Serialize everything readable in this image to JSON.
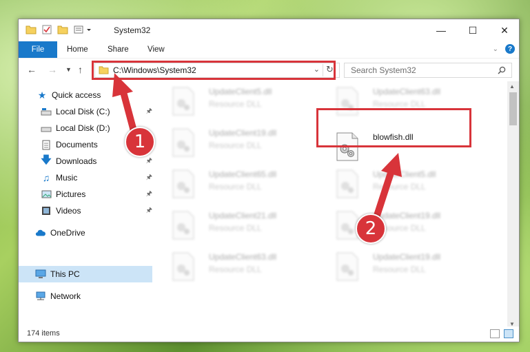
{
  "window": {
    "title": "System32",
    "controls": {
      "minimize": "—",
      "maximize": "☐",
      "close": "✕"
    }
  },
  "ribbon": {
    "file_tab": "File",
    "tabs": [
      "Home",
      "Share",
      "View"
    ]
  },
  "navigation": {
    "address": "C:\\Windows\\System32",
    "search_placeholder": "Search System32"
  },
  "sidebar": {
    "quick_access": "Quick access",
    "items": [
      {
        "label": "Local Disk (C:)",
        "icon": "drive-icon",
        "pinned": true
      },
      {
        "label": "Local Disk (D:)",
        "icon": "drive-icon",
        "pinned": false
      },
      {
        "label": "Documents",
        "icon": "documents-icon",
        "pinned": true
      },
      {
        "label": "Downloads",
        "icon": "download-icon",
        "pinned": true
      },
      {
        "label": "Music",
        "icon": "music-icon",
        "pinned": true
      },
      {
        "label": "Pictures",
        "icon": "pictures-icon",
        "pinned": true
      },
      {
        "label": "Videos",
        "icon": "videos-icon",
        "pinned": true
      }
    ],
    "onedrive": "OneDrive",
    "this_pc": "This PC",
    "network": "Network"
  },
  "files": [
    {
      "name": "UpdateClient5.dll",
      "type": "Resource DLL",
      "blurred": true
    },
    {
      "name": "UpdateClient63.dll",
      "type": "Resource DLL",
      "blurred": true
    },
    {
      "name": "UpdateClient19.dll",
      "type": "Resource DLL",
      "blurred": true
    },
    {
      "name": "blowfish.dll",
      "type": "",
      "blurred": false
    },
    {
      "name": "UpdateClient65.dll",
      "type": "Resource DLL",
      "blurred": true
    },
    {
      "name": "UpdateClient5.dll",
      "type": "Resource DLL",
      "blurred": true
    },
    {
      "name": "UpdateClient21.dll",
      "type": "Resource DLL",
      "blurred": true
    },
    {
      "name": "UpdateClient19.dll",
      "type": "Resource DLL",
      "blurred": true
    },
    {
      "name": "UpdateClient63.dll",
      "type": "Resource DLL",
      "blurred": true
    },
    {
      "name": "UpdateClient19.dll",
      "type": "Resource DLL",
      "blurred": true
    }
  ],
  "status": {
    "item_count": "174 items"
  },
  "annotations": {
    "step1": "1",
    "step2": "2"
  },
  "colors": {
    "accent": "#1979ca",
    "highlight": "#d8343a",
    "selection": "#cce4f7"
  }
}
